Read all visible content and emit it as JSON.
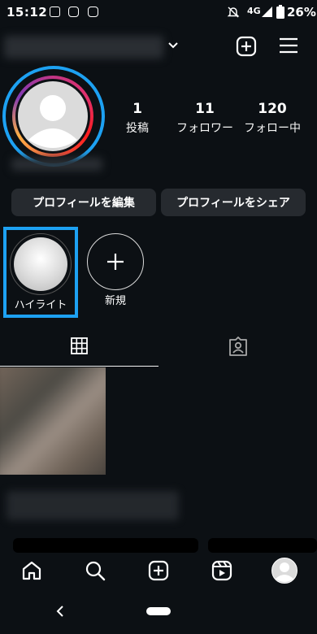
{
  "status_bar": {
    "time": "15:12",
    "network": "4G",
    "battery": "26%"
  },
  "profile": {
    "stats": [
      {
        "value": "1",
        "label": "投稿"
      },
      {
        "value": "11",
        "label": "フォロワー"
      },
      {
        "value": "120",
        "label": "フォロー中"
      }
    ],
    "edit_button": "プロフィールを編集",
    "share_button": "プロフィールをシェア"
  },
  "highlights": {
    "items": [
      {
        "label": "ハイライト"
      },
      {
        "label": "新規"
      }
    ]
  },
  "tabs": [
    {
      "icon": "grid-icon",
      "active": true
    },
    {
      "icon": "tagged-icon",
      "active": false
    }
  ],
  "bottom_nav": [
    {
      "icon": "home-icon"
    },
    {
      "icon": "search-icon"
    },
    {
      "icon": "create-icon"
    },
    {
      "icon": "reels-icon"
    },
    {
      "icon": "profile-avatar"
    }
  ],
  "colors": {
    "background": "#0c1014",
    "highlight_outline": "#1da1f2",
    "button_bg": "#262a2f"
  }
}
